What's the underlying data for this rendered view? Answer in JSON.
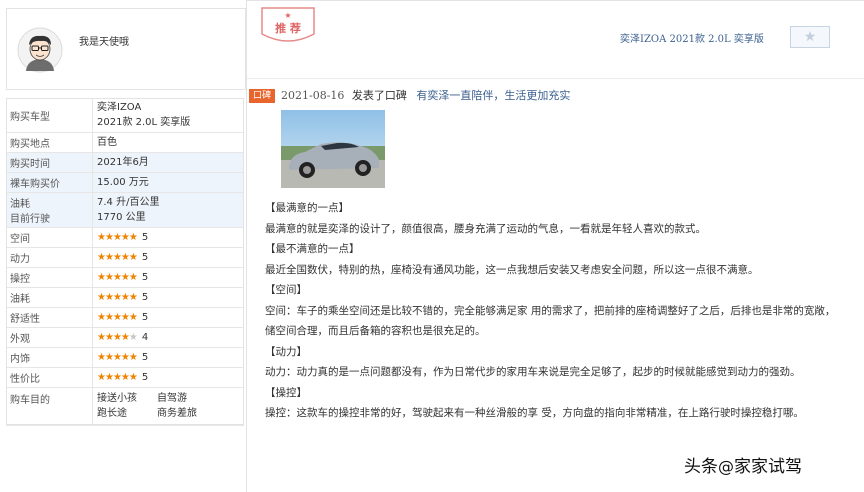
{
  "user": {
    "name": "我是天使哦",
    "avatar_icon": "cartoon-avatar-icon"
  },
  "info": [
    {
      "key": "购买车型",
      "lines": [
        "奕泽IZOA",
        "2021款 2.0L 奕享版"
      ],
      "alt": false
    },
    {
      "key": "购买地点",
      "lines": [
        "百色"
      ],
      "alt": false
    },
    {
      "key": "购买时间",
      "lines": [
        "2021年6月"
      ],
      "alt": true
    },
    {
      "key": "裸车购买价",
      "lines": [
        "15.00 万元"
      ],
      "alt": true
    }
  ],
  "fuel": {
    "key1": "油耗",
    "key2": "目前行驶",
    "value1": "7.4 升/百公里",
    "value2": "1770 公里"
  },
  "ratings": [
    {
      "key": "空间",
      "score": "5",
      "stars": 5
    },
    {
      "key": "动力",
      "score": "5",
      "stars": 5
    },
    {
      "key": "操控",
      "score": "5",
      "stars": 5
    },
    {
      "key": "油耗",
      "score": "5",
      "stars": 5
    },
    {
      "key": "舒适性",
      "score": "5",
      "stars": 5
    },
    {
      "key": "外观",
      "score": "4",
      "stars": 4
    },
    {
      "key": "内饰",
      "score": "5",
      "stars": 5
    },
    {
      "key": "性价比",
      "score": "5",
      "stars": 5
    }
  ],
  "purpose": {
    "key": "购车目的",
    "items": [
      "接送小孩",
      "自驾游",
      "跑长途",
      "商务差旅"
    ]
  },
  "header": {
    "stamp_text": "推 荐",
    "model_link": "奕泽IZOA 2021款 2.0L 奕享版",
    "favorite_icon": "star-icon"
  },
  "review": {
    "tag": "口碑",
    "date": "2021-08-16",
    "action": "发表了口碑",
    "title": "有奕泽一直陪伴，生活更加充实",
    "image_icon": "car-photo",
    "paragraphs": [
      "【最满意的一点】",
      "最满意的就是奕泽的设计了，颜值很高，腰身充满了运动的气息，一看就是年轻人喜欢的款式。",
      "【最不满意的一点】",
      "最近全国数伏，特别的热，座椅没有通风功能，这一点我想后安装又考虑安全问题，所以这一点很不满意。",
      "【空间】",
      "空间：车子的乘坐空间还是比较不错的，完全能够满足家 用的需求了，把前排的座椅调整好了之后，后排也是非常的宽敞，储空间合理，而且后备箱的容积也是很充足的。",
      "【动力】",
      "动力：动力真的是一点问题都没有，作为日常代步的家用车来说是完全足够了，起步的时候就能感觉到动力的强劲。",
      "【操控】",
      "操控：这款车的操控非常的好，驾驶起来有一种丝滑般的享 受，方向盘的指向非常精准，在上路行驶时操控稳打哪。"
    ]
  },
  "watermark": {
    "prefix": "头条",
    "at": "@",
    "name": "家家试驾"
  },
  "colors": {
    "accent": "#e8662d",
    "star": "#f08300",
    "link": "#3a5f8f",
    "stamp": "#d9534f"
  }
}
